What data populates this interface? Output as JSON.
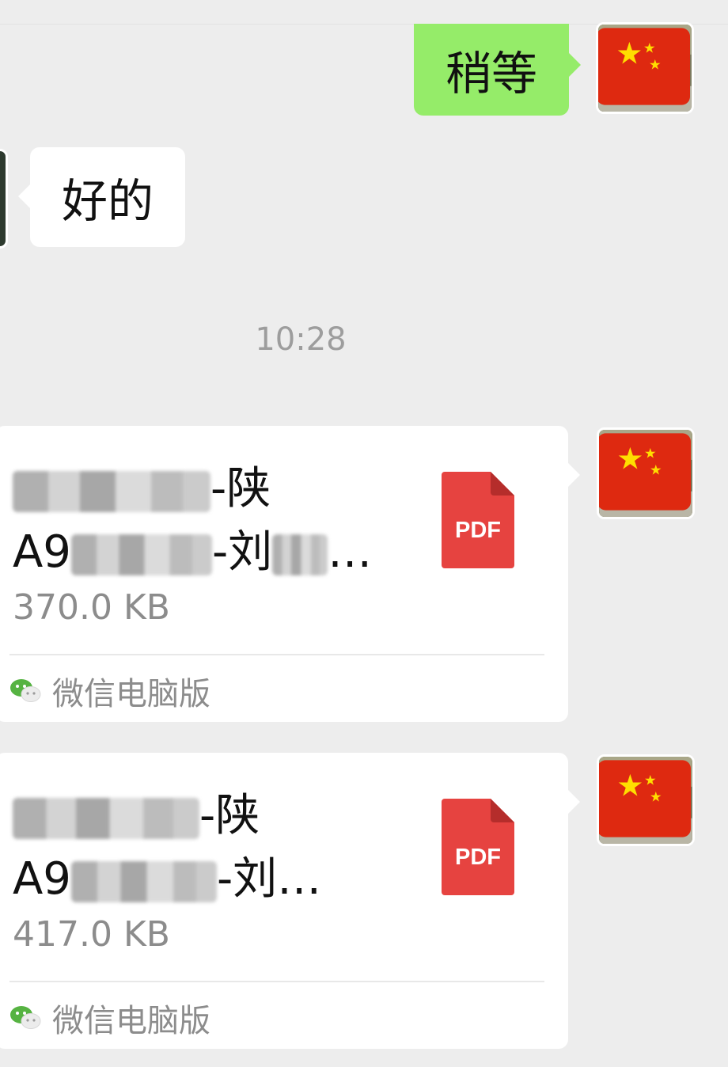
{
  "messages": [
    {
      "direction": "outgoing",
      "type": "text",
      "text": "稍等"
    },
    {
      "direction": "incoming",
      "type": "text",
      "text": "好的"
    }
  ],
  "timestamp": "10:28",
  "files": [
    {
      "name_line1_visible": "-陕",
      "name_line2_prefix": "A9",
      "name_line2_suffix": "-刘",
      "name_ellipsis": "…",
      "size": "370.0 KB",
      "icon_label": "PDF",
      "source": "微信电脑版"
    },
    {
      "name_line1_visible": "-陕",
      "name_line2_prefix": "A9",
      "name_line2_suffix": "-刘",
      "name_ellipsis": "…",
      "size": "417.0 KB",
      "icon_label": "PDF",
      "source": "微信电脑版"
    }
  ],
  "colors": {
    "background": "#ededed",
    "outgoing_bubble": "#95ec69",
    "incoming_bubble": "#ffffff",
    "pdf_red": "#e64340",
    "secondary_text": "#8c8c8c"
  }
}
